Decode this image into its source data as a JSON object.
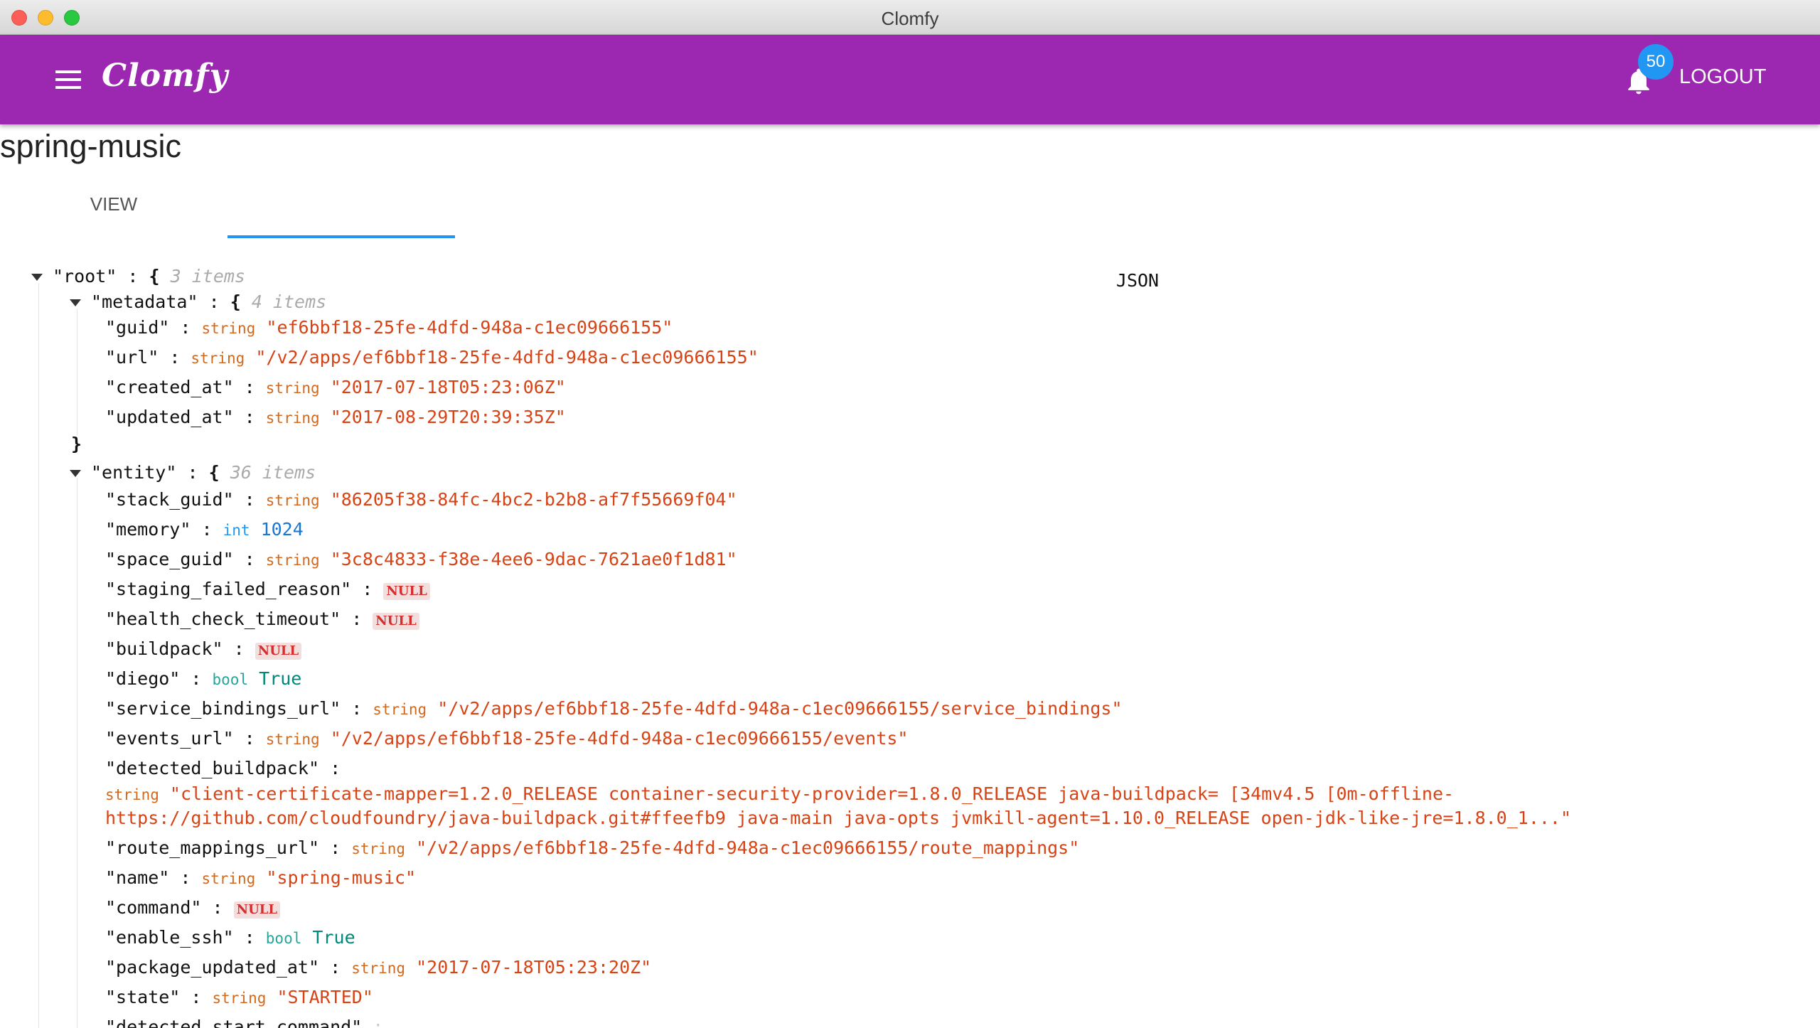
{
  "window": {
    "title": "Clomfy"
  },
  "appbar": {
    "brand": "Clomfy",
    "notifications_count": "50",
    "logout_label": "LOGOUT"
  },
  "page": {
    "title": "spring-music"
  },
  "tabs": [
    {
      "label": "VIEW"
    },
    {
      "label": "JSON"
    }
  ],
  "json_view": {
    "root": {
      "key": "\"root\"",
      "count": "3 items"
    },
    "metadata": {
      "key": "\"metadata\"",
      "count": "4 items",
      "fields": [
        {
          "key": "\"guid\"",
          "type": "string",
          "value": "\"ef6bbf18-25fe-4dfd-948a-c1ec09666155\""
        },
        {
          "key": "\"url\"",
          "type": "string",
          "value": "\"/v2/apps/ef6bbf18-25fe-4dfd-948a-c1ec09666155\""
        },
        {
          "key": "\"created_at\"",
          "type": "string",
          "value": "\"2017-07-18T05:23:06Z\""
        },
        {
          "key": "\"updated_at\"",
          "type": "string",
          "value": "\"2017-08-29T20:39:35Z\""
        }
      ]
    },
    "entity": {
      "key": "\"entity\"",
      "count": "36 items",
      "fields": [
        {
          "key": "\"stack_guid\"",
          "type": "string",
          "value": "\"86205f38-84fc-4bc2-b2b8-af7f55669f04\""
        },
        {
          "key": "\"memory\"",
          "type": "int",
          "value": "1024"
        },
        {
          "key": "\"space_guid\"",
          "type": "string",
          "value": "\"3c8c4833-f38e-4ee6-9dac-7621ae0f1d81\""
        },
        {
          "key": "\"staging_failed_reason\"",
          "type": "null",
          "value": "NULL"
        },
        {
          "key": "\"health_check_timeout\"",
          "type": "null",
          "value": "NULL"
        },
        {
          "key": "\"buildpack\"",
          "type": "null",
          "value": "NULL"
        },
        {
          "key": "\"diego\"",
          "type": "bool",
          "value": "True"
        },
        {
          "key": "\"service_bindings_url\"",
          "type": "string",
          "value": "\"/v2/apps/ef6bbf18-25fe-4dfd-948a-c1ec09666155/service_bindings\""
        },
        {
          "key": "\"events_url\"",
          "type": "string",
          "value": "\"/v2/apps/ef6bbf18-25fe-4dfd-948a-c1ec09666155/events\""
        },
        {
          "key": "\"detected_buildpack\"",
          "type": "string",
          "value_line1": "\"client-certificate-mapper=1.2.0_RELEASE container-security-provider=1.8.0_RELEASE java-buildpack= [34mv4.5 [0m-offline-",
          "value_line2": "https://github.com/cloudfoundry/java-buildpack.git#ffeefb9 java-main java-opts jvmkill-agent=1.10.0_RELEASE open-jdk-like-jre=1.8.0_1...\""
        },
        {
          "key": "\"route_mappings_url\"",
          "type": "string",
          "value": "\"/v2/apps/ef6bbf18-25fe-4dfd-948a-c1ec09666155/route_mappings\""
        },
        {
          "key": "\"name\"",
          "type": "string",
          "value": "\"spring-music\""
        },
        {
          "key": "\"command\"",
          "type": "null",
          "value": "NULL"
        },
        {
          "key": "\"enable_ssh\"",
          "type": "bool",
          "value": "True"
        },
        {
          "key": "\"package_updated_at\"",
          "type": "string",
          "value": "\"2017-07-18T05:23:20Z\""
        },
        {
          "key": "\"state\"",
          "type": "string",
          "value": "\"STARTED\""
        },
        {
          "key": "\"detected_start_command\"",
          "type": "",
          "value": ""
        }
      ]
    }
  },
  "colors": {
    "appbar": "#9c27b0",
    "accent": "#2196f3",
    "string_value": "#d84315",
    "null_badge": "#d32f2f"
  }
}
